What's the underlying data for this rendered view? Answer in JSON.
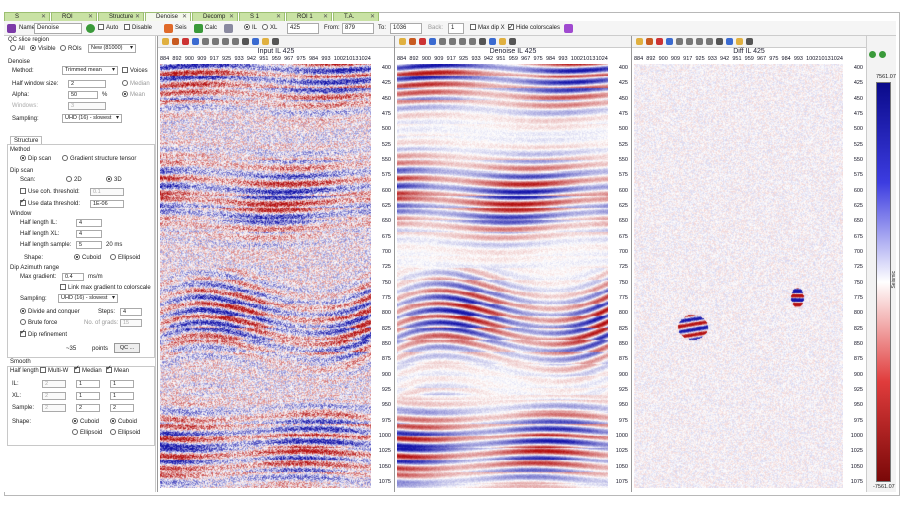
{
  "tabs": [
    {
      "label": "S"
    },
    {
      "label": "ROI"
    },
    {
      "label": "Structure"
    },
    {
      "label": "Denoise"
    },
    {
      "label": "Decomp"
    },
    {
      "label": "S 1"
    },
    {
      "label": "ROI 1"
    },
    {
      "label": "T.A."
    }
  ],
  "toolbar": {
    "name_label": "Name:",
    "name_value": "Denoise",
    "auto_label": "Auto",
    "disable_label": "Disable",
    "sets_label": "Seis",
    "calc_label": "Calc",
    "il_label": "IL",
    "xl_label": "XL",
    "il_value": "425",
    "from_label": "From:",
    "from_value": "879",
    "to_label": "To:",
    "to_value": "1036",
    "back_label": "Back:",
    "back_value": "1",
    "maxdip_label": "Max dip X",
    "hidecb_label": "Hide colorscales"
  },
  "left": {
    "qc_label": "QC slice region",
    "qc_all": "All",
    "qc_visible": "Visible",
    "qc_rois": "ROIs",
    "qc_select": "New (81000)",
    "denoise_label": "Denoise",
    "method_label": "Method:",
    "method_value": "Trimmed mean",
    "voices_label": "Voices",
    "half_window_label": "Half window size:",
    "half_window_value": "2",
    "median_label": "Median",
    "alpha_label": "Alpha:",
    "alpha_value": "50",
    "alpha_unit": "%",
    "mean_label": "Mean",
    "windows_label": "Windows:",
    "windows_value": "3",
    "sampling_label": "Sampling:",
    "sampling_value": "UHD (16) - slowest",
    "structure_tab": "Structure",
    "method2_label": "Method",
    "dip_scan": "Dip scan",
    "gst": "Gradient structure tensor",
    "dipscan_group": "Dip scan",
    "scan_label": "Scan:",
    "scan_2d": "2D",
    "scan_3d": "3D",
    "coh_label": "Use coh. threshold:",
    "coh_value": "0.1",
    "data_label": "Use data threshold:",
    "data_value": "1E-06",
    "window_group": "Window",
    "half_il_label": "Half length IL:",
    "half_il_value": "4",
    "half_xl_label": "Half length XL:",
    "half_xl_value": "4",
    "half_sample_label": "Half length sample:",
    "half_sample_value": "5",
    "half_sample_unit": "20 ms",
    "shape_label": "Shape:",
    "cuboid": "Cuboid",
    "ellipsoid": "Ellipsoid",
    "dipaz_group": "Dip Azimuth range",
    "max_grad_label": "Max gradient:",
    "max_grad_value": "0.4",
    "max_grad_unit": "ms/m",
    "link_label": "Link max gradient to colorscale",
    "sampling2_label": "Sampling:",
    "sampling2_value": "UHD (16) - slowest",
    "divide_label": "Divide and conquer",
    "steps_label": "Steps:",
    "steps_value": "4",
    "brute_label": "Brute force",
    "nograds_label": "No. of grads:",
    "nograds_value": "15",
    "dip_ref_label": "Dip refinement",
    "points_prefix": "~35",
    "points_label": "points",
    "qc_button": "QC ...",
    "smooth_group": "Smooth",
    "half_length_label": "Half length",
    "multiw_label": "Multi-W",
    "median2_label": "Median",
    "mean2_label": "Mean",
    "il_label": "IL:",
    "xl_label": "XL:",
    "sample_label": "Sample:",
    "shape2_label": "Shape:",
    "col1_il": "2",
    "col1_xl": "2",
    "col1_sample": "2",
    "col2_il": "1",
    "col2_xl": "1",
    "col2_sample": "2",
    "col3_il": "1",
    "col3_xl": "1",
    "col3_sample": "2",
    "cuboid2": "Cuboid",
    "cuboid3": "Cuboid",
    "ellipsoid2": "Ellipsoid",
    "ellipsoid3": "Ellipsoid"
  },
  "panels": [
    {
      "title": "Input   IL 425",
      "type": "input"
    },
    {
      "title": "Denoise   IL 425",
      "type": "denoise"
    },
    {
      "title": "Diff   IL 425",
      "type": "diff"
    }
  ],
  "x_ticks": [
    "884",
    "892",
    "900",
    "909",
    "917",
    "925",
    "933",
    "942",
    "951",
    "959",
    "967",
    "975",
    "984",
    "993",
    "1002",
    "1013",
    "1024"
  ],
  "y_ticks": [
    "400",
    "425",
    "450",
    "475",
    "500",
    "525",
    "550",
    "575",
    "600",
    "625",
    "650",
    "675",
    "700",
    "725",
    "750",
    "775",
    "800",
    "825",
    "850",
    "875",
    "900",
    "925",
    "950",
    "975",
    "1000",
    "1025",
    "1050",
    "1075"
  ],
  "colorbar": {
    "max_label": "7561.07",
    "min_label": "-7561.07",
    "axis_label": "Seismic",
    "colors": {
      "positive": "#1a1aa8",
      "negative": "#b01010",
      "mid": "#ffffff"
    }
  }
}
